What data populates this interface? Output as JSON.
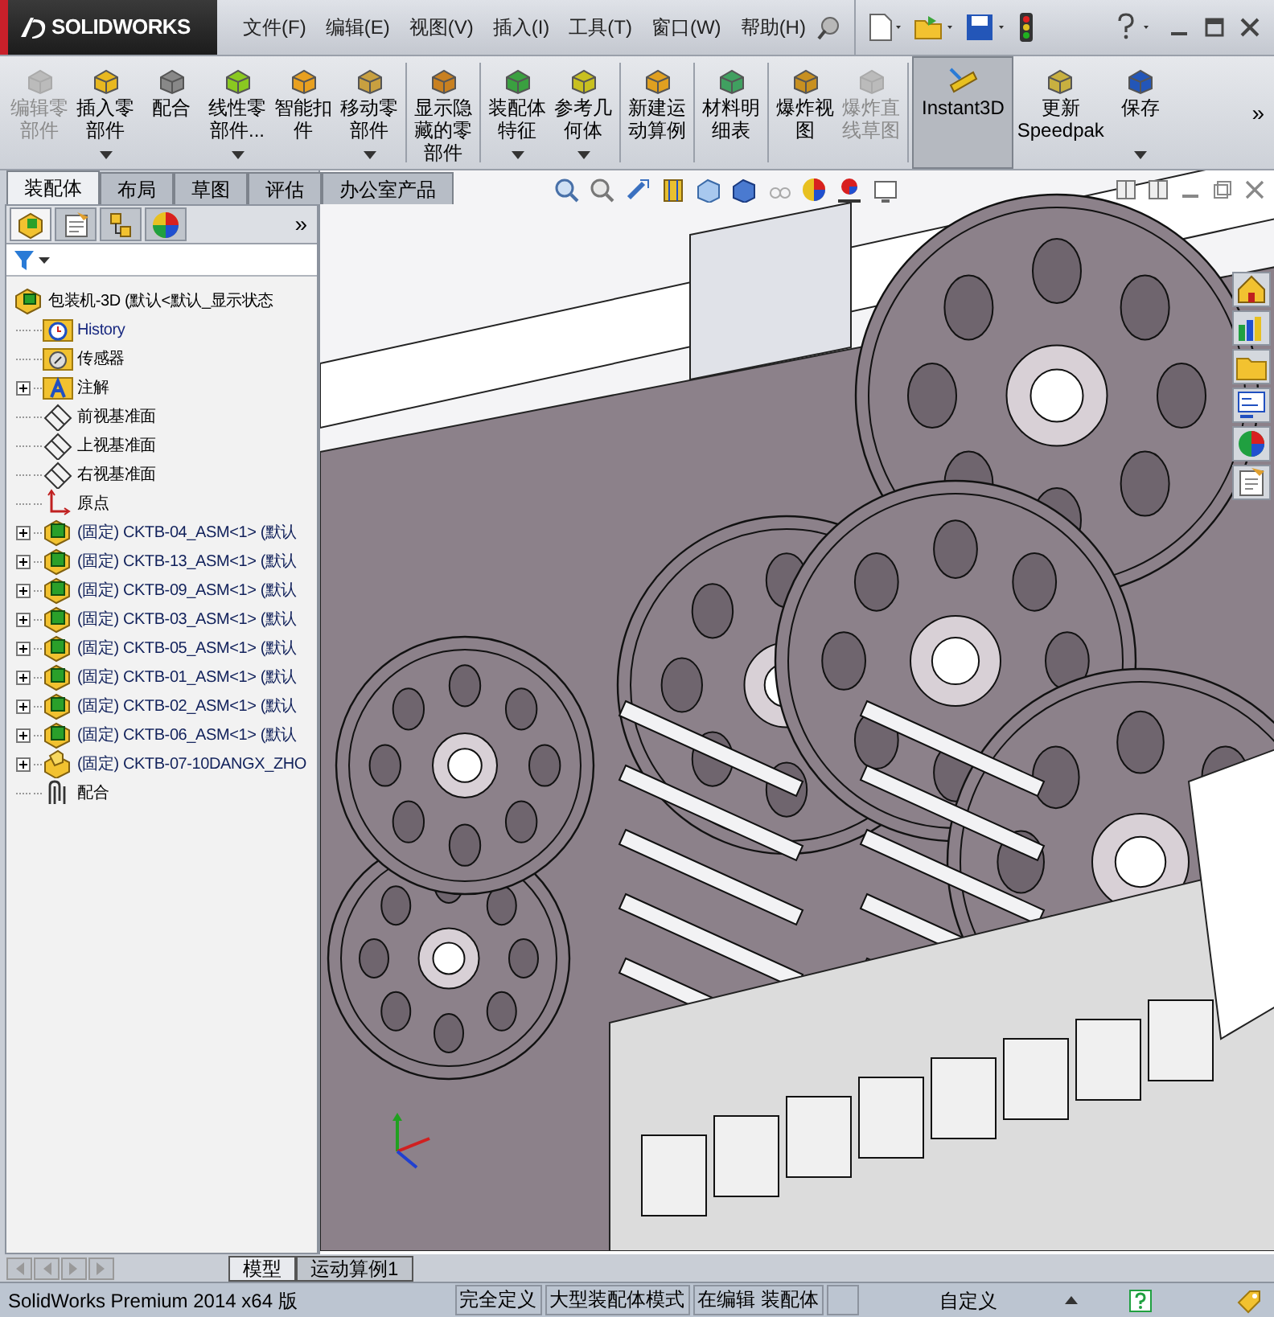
{
  "menu_bar": {
    "logo": "SOLIDWORKS",
    "items": [
      "文件(F)",
      "编辑(E)",
      "视图(V)",
      "插入(I)",
      "工具(T)",
      "窗口(W)",
      "帮助(H)"
    ]
  },
  "command_manager": {
    "buttons": [
      {
        "label": "编辑零部件",
        "disabled": true,
        "dropdown": false,
        "pressed": false
      },
      {
        "label": "插入零部件",
        "disabled": false,
        "dropdown": true,
        "pressed": false
      },
      {
        "label": "配合",
        "disabled": false,
        "dropdown": false,
        "pressed": false
      },
      {
        "label": "线性零部件...",
        "disabled": false,
        "dropdown": true,
        "pressed": false
      },
      {
        "label": "智能扣件",
        "disabled": false,
        "dropdown": false,
        "pressed": false
      },
      {
        "label": "移动零部件",
        "disabled": false,
        "dropdown": true,
        "pressed": false
      },
      {
        "label": "显示隐藏的零部件",
        "disabled": false,
        "dropdown": false,
        "pressed": false
      },
      {
        "label": "装配体特征",
        "disabled": false,
        "dropdown": true,
        "pressed": false
      },
      {
        "label": "参考几何体",
        "disabled": false,
        "dropdown": true,
        "pressed": false
      },
      {
        "label": "新建运动算例",
        "disabled": false,
        "dropdown": false,
        "pressed": false
      },
      {
        "label": "材料明细表",
        "disabled": false,
        "dropdown": false,
        "pressed": false
      },
      {
        "label": "爆炸视图",
        "disabled": false,
        "dropdown": false,
        "pressed": false
      },
      {
        "label": "爆炸直线草图",
        "disabled": true,
        "dropdown": false,
        "pressed": false
      },
      {
        "label": "Instant3D",
        "disabled": false,
        "dropdown": false,
        "pressed": true
      },
      {
        "label": "更新 Speedpak",
        "disabled": false,
        "dropdown": false,
        "pressed": false
      },
      {
        "label": "保存",
        "disabled": false,
        "dropdown": true,
        "pressed": false
      }
    ],
    "overflow": "»"
  },
  "command_tabs": [
    {
      "label": "装配体",
      "selected": true
    },
    {
      "label": "布局",
      "selected": false
    },
    {
      "label": "草图",
      "selected": false
    },
    {
      "label": "评估",
      "selected": false
    },
    {
      "label": "办公室产品",
      "selected": false
    }
  ],
  "feature_tree": {
    "panel_tabs": [
      {
        "kind": "tree",
        "selected": true
      },
      {
        "kind": "property",
        "selected": false
      },
      {
        "kind": "config",
        "selected": false
      },
      {
        "kind": "display",
        "selected": false
      }
    ],
    "overflow": "»",
    "root": {
      "label": "包装机-3D  (默认<默认_显示状态",
      "kind": "assembly"
    },
    "items": [
      {
        "label": "History",
        "kind": "history",
        "expandable": false
      },
      {
        "label": "传感器",
        "kind": "sensors",
        "expandable": false
      },
      {
        "label": "注解",
        "kind": "annotations",
        "expandable": true
      },
      {
        "label": "前视基准面",
        "kind": "plane",
        "expandable": false
      },
      {
        "label": "上视基准面",
        "kind": "plane",
        "expandable": false
      },
      {
        "label": "右视基准面",
        "kind": "plane",
        "expandable": false
      },
      {
        "label": "原点",
        "kind": "origin",
        "expandable": false
      },
      {
        "label": "(固定) CKTB-04_ASM<1> (默认",
        "kind": "component",
        "expandable": true
      },
      {
        "label": "(固定) CKTB-13_ASM<1> (默认",
        "kind": "component",
        "expandable": true
      },
      {
        "label": "(固定) CKTB-09_ASM<1> (默认",
        "kind": "component",
        "expandable": true
      },
      {
        "label": "(固定) CKTB-03_ASM<1> (默认",
        "kind": "component",
        "expandable": true
      },
      {
        "label": "(固定) CKTB-05_ASM<1> (默认",
        "kind": "component",
        "expandable": true
      },
      {
        "label": "(固定) CKTB-01_ASM<1> (默认",
        "kind": "component",
        "expandable": true
      },
      {
        "label": "(固定) CKTB-02_ASM<1> (默认",
        "kind": "component",
        "expandable": true
      },
      {
        "label": "(固定) CKTB-06_ASM<1> (默认",
        "kind": "component",
        "expandable": true
      },
      {
        "label": "(固定) CKTB-07-10DANGX_ZHO",
        "kind": "part",
        "expandable": true
      },
      {
        "label": "配合",
        "kind": "mates",
        "expandable": false
      }
    ]
  },
  "bottom_tabs": [
    {
      "label": "模型",
      "selected": true
    },
    {
      "label": "运动算例1",
      "selected": false
    }
  ],
  "status_bar": {
    "product": "SolidWorks Premium 2014 x64 版",
    "fields": [
      "完全定义",
      "大型装配体模式",
      "在编辑 装配体"
    ],
    "units": "自定义"
  }
}
